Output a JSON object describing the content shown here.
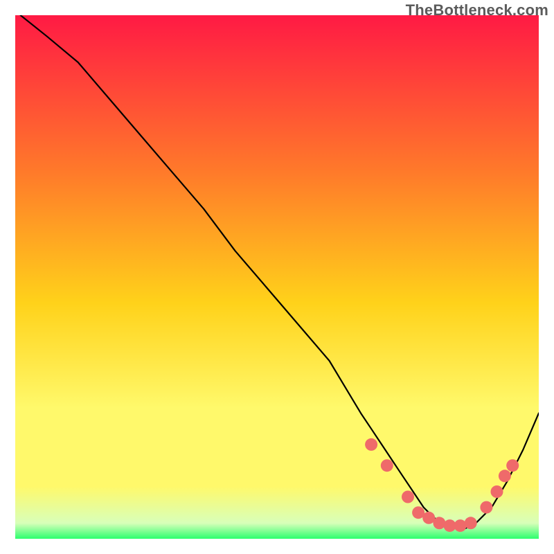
{
  "watermark": "TheBottleneck.com",
  "colors": {
    "gradient_top": "#ff1a44",
    "gradient_mid_upper": "#ff7a2a",
    "gradient_mid": "#ffd21a",
    "gradient_mid_lower": "#fff96b",
    "gradient_green_pale": "#d8ffb9",
    "gradient_green": "#2cff6e",
    "line": "#000000",
    "dot_fill": "#ef6a6a",
    "dot_stroke": "#c94f4f"
  },
  "chart_data": {
    "type": "line",
    "title": "",
    "xlabel": "",
    "ylabel": "",
    "xlim": [
      0,
      100
    ],
    "ylim": [
      0,
      100
    ],
    "grid": false,
    "series": [
      {
        "name": "bottleneck-curve",
        "x": [
          1,
          6,
          12,
          18,
          24,
          30,
          36,
          42,
          48,
          54,
          60,
          63,
          66,
          68,
          70,
          72,
          74,
          76,
          78,
          80,
          82,
          84,
          86,
          88,
          91,
          94,
          97,
          100
        ],
        "y": [
          100,
          96,
          91,
          84,
          77,
          70,
          63,
          55,
          48,
          41,
          34,
          29,
          24,
          21,
          18,
          15,
          12,
          9,
          6,
          4,
          3,
          2,
          2,
          3,
          6,
          11,
          17,
          24
        ]
      }
    ],
    "markers": [
      {
        "x": 68,
        "y": 18
      },
      {
        "x": 71,
        "y": 14
      },
      {
        "x": 75,
        "y": 8
      },
      {
        "x": 77,
        "y": 5
      },
      {
        "x": 79,
        "y": 4
      },
      {
        "x": 81,
        "y": 3
      },
      {
        "x": 83,
        "y": 2.5
      },
      {
        "x": 85,
        "y": 2.5
      },
      {
        "x": 87,
        "y": 3
      },
      {
        "x": 90,
        "y": 6
      },
      {
        "x": 92,
        "y": 9
      },
      {
        "x": 93.5,
        "y": 12
      },
      {
        "x": 95,
        "y": 14
      }
    ]
  }
}
